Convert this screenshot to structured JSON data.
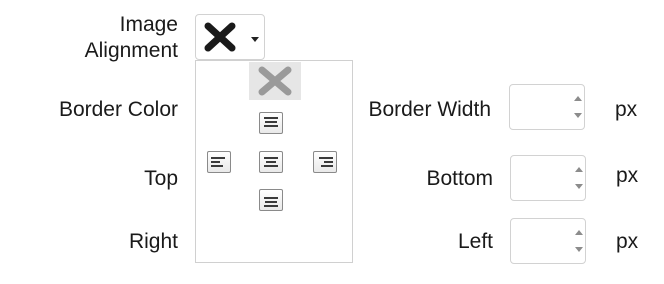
{
  "labels": {
    "image_alignment_line1": "Image",
    "image_alignment_line2": "Alignment",
    "border_color": "Border Color",
    "top": "Top",
    "right": "Right",
    "border_width": "Border Width",
    "bottom": "Bottom",
    "left": "Left"
  },
  "alignment_dropdown": {
    "selected_icon": "no-alignment-x-icon",
    "options": [
      "none-x-icon",
      "align-top-icon",
      "align-left-icon",
      "align-center-icon",
      "align-right-icon",
      "align-bottom-icon"
    ],
    "highlighted_option": "none-x-icon"
  },
  "inputs": {
    "border_width": {
      "value": "",
      "unit": "px"
    },
    "bottom": {
      "value": "",
      "unit": "px"
    },
    "left": {
      "value": "",
      "unit": "px"
    }
  },
  "colors": {
    "border": "#d2d2d2",
    "highlight": "#e6e6e6",
    "icon_dark": "#1a1a1a",
    "icon_grey": "#9a9a9a"
  }
}
